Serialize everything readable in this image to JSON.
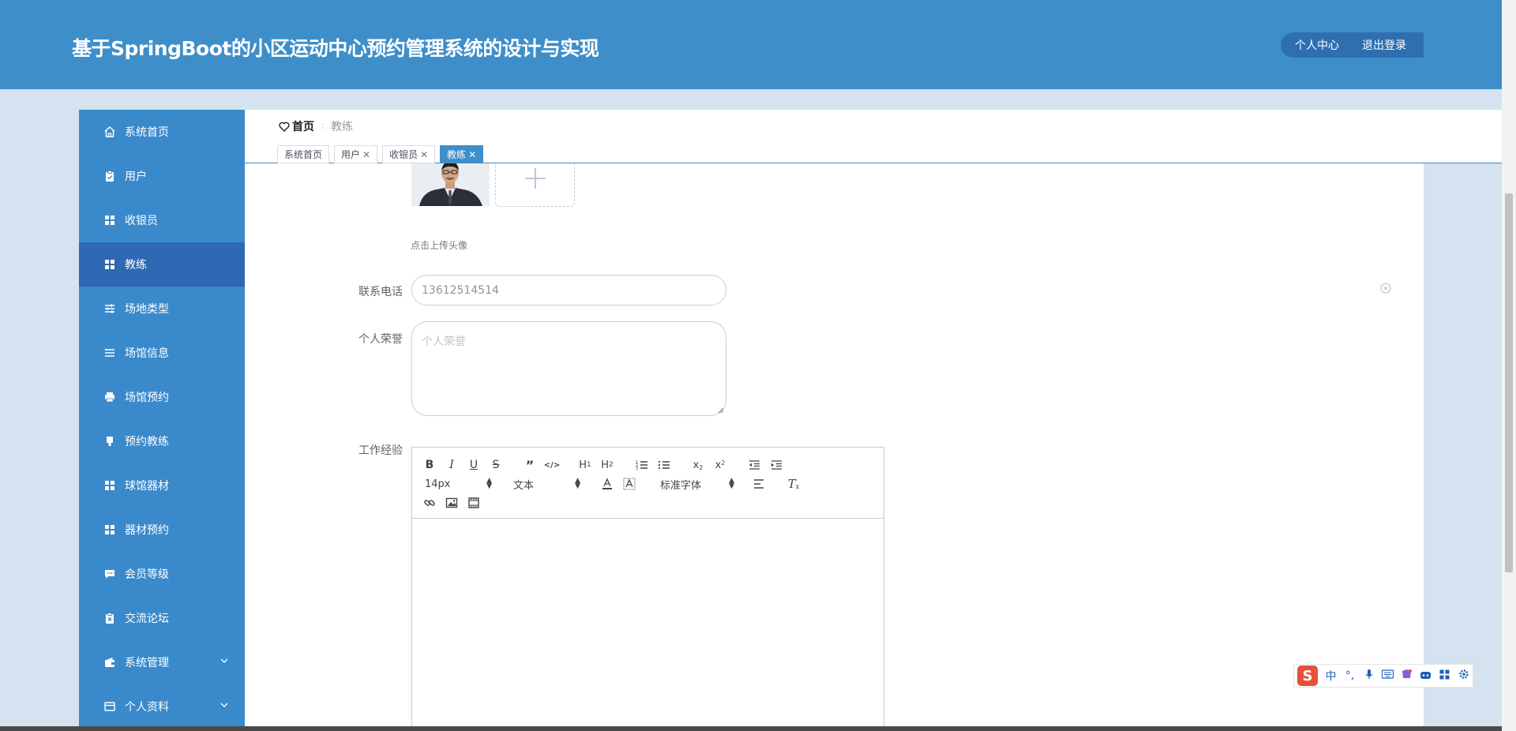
{
  "header": {
    "title": "基于SpringBoot的小区运动中心预约管理系统的设计与实现",
    "profile_link": "个人中心",
    "logout_link": "退出登录"
  },
  "sidebar": {
    "items": [
      {
        "label": "系统首页",
        "icon": "home-icon"
      },
      {
        "label": "用户",
        "icon": "clipboard-icon"
      },
      {
        "label": "收银员",
        "icon": "grid-icon"
      },
      {
        "label": "教练",
        "icon": "grid-icon",
        "active": true
      },
      {
        "label": "场地类型",
        "icon": "sliders-icon"
      },
      {
        "label": "场馆信息",
        "icon": "list-icon"
      },
      {
        "label": "场馆预约",
        "icon": "printer-icon"
      },
      {
        "label": "预约教练",
        "icon": "stamp-icon"
      },
      {
        "label": "球馆器材",
        "icon": "grid-icon"
      },
      {
        "label": "器材预约",
        "icon": "grid-icon"
      },
      {
        "label": "会员等级",
        "icon": "chat-icon"
      },
      {
        "label": "交流论坛",
        "icon": "clipboard-x-icon"
      },
      {
        "label": "系统管理",
        "icon": "wallet-icon"
      },
      {
        "label": "个人资料",
        "icon": "card-icon"
      }
    ]
  },
  "breadcrumb": {
    "home": "首页",
    "separator": "∶",
    "current": "教练"
  },
  "tabs": [
    {
      "label": "系统首页",
      "closable": false
    },
    {
      "label": "用户",
      "closable": true
    },
    {
      "label": "收银员",
      "closable": true
    },
    {
      "label": "教练",
      "closable": true,
      "active": true
    }
  ],
  "form": {
    "avatar_tip": "点击上传头像",
    "phone_label": "联系电话",
    "phone_value": "13612514514",
    "honor_label": "个人荣誉",
    "honor_placeholder": "个人荣誉",
    "experience_label": "工作经验"
  },
  "editor": {
    "font_size": "14px",
    "block_format": "文本",
    "font_family": "标准字体"
  },
  "ime": {
    "logo": "S",
    "mode": "中",
    "punct": "°,"
  },
  "colors": {
    "header": "#3e8ec9",
    "sidebar": "#3a8acb",
    "sidebar_active": "#2f68b3",
    "page_bg": "#d4e3ef"
  }
}
